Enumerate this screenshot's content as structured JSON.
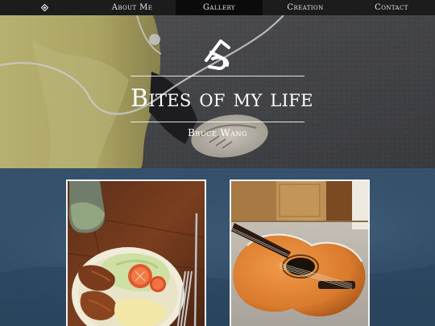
{
  "nav": {
    "home_icon": "diamond-logo-icon",
    "items": [
      {
        "label": "About Me"
      },
      {
        "label": "Gallery",
        "active": true
      },
      {
        "label": "Creation"
      },
      {
        "label": "Contact"
      }
    ]
  },
  "hero": {
    "logo_icon": "b-monogram-logo-icon",
    "title": "Bites of my life",
    "subtitle": "Bruce Wang"
  },
  "gallery": {
    "photos": [
      {
        "subject": "food-plate-photo"
      },
      {
        "subject": "acoustic-guitar-photo"
      }
    ]
  },
  "colors": {
    "nav_bg": "#1c1c1c",
    "nav_active_bg": "#0b0b0b",
    "nav_text": "#e6e6e6",
    "gallery_bg": "#2f4a63",
    "text_light": "#ffffff"
  }
}
